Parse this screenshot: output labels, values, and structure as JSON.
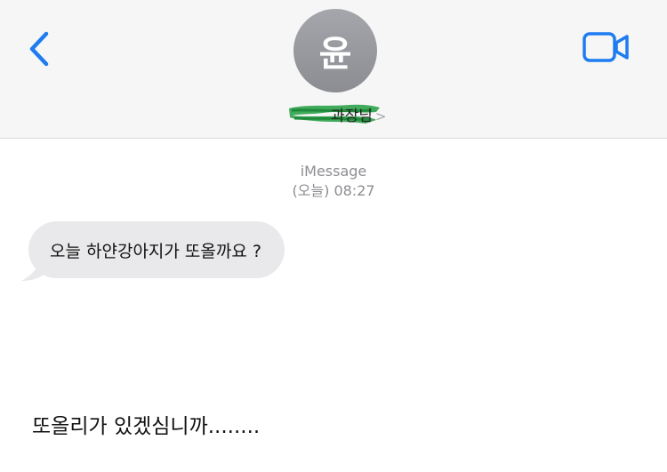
{
  "header": {
    "back_icon": "chevron-left-icon",
    "avatar_initial": "윤",
    "contact_name_visible": "과장님",
    "contact_chevron": ">",
    "video_icon": "video-camera-icon",
    "accent_color": "#1e7cf0"
  },
  "conversation": {
    "service": "iMessage",
    "timestamp": "(오늘) 08:27",
    "messages": [
      {
        "direction": "incoming",
        "text": "오늘 하얀강아지가 또올까요 ?"
      }
    ]
  },
  "caption": "또올리가 있겠심니까........"
}
